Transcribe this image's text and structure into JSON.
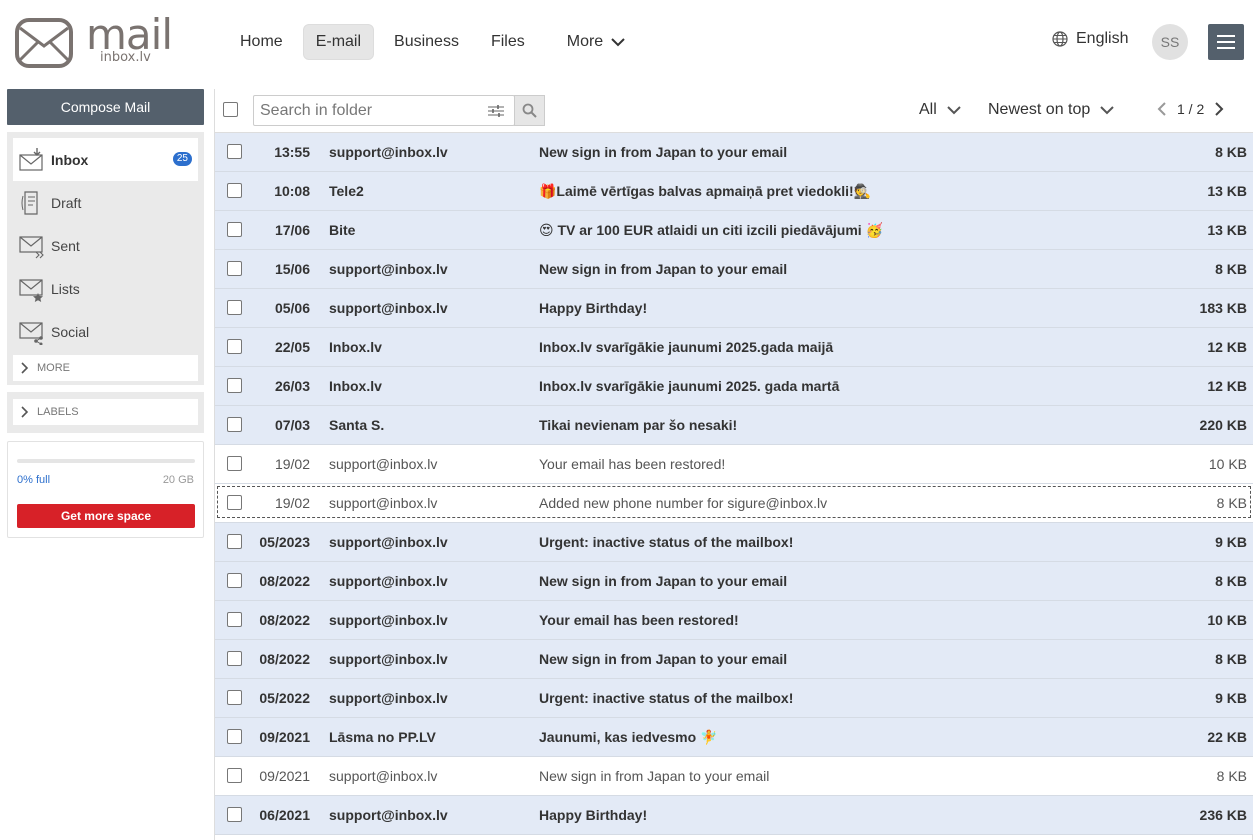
{
  "brand": {
    "name": "mail",
    "sub": "inbox.lv"
  },
  "nav": {
    "items": [
      {
        "label": "Home",
        "active": false
      },
      {
        "label": "E-mail",
        "active": true
      },
      {
        "label": "Business",
        "active": false
      },
      {
        "label": "Files",
        "active": false
      }
    ],
    "more_label": "More"
  },
  "header": {
    "language": "English",
    "avatar_initials": "SS"
  },
  "sidebar": {
    "compose_label": "Compose Mail",
    "folders": [
      {
        "label": "Inbox",
        "badge": "25",
        "icon": "inbox-icon"
      },
      {
        "label": "Draft",
        "icon": "draft-icon"
      },
      {
        "label": "Sent",
        "icon": "sent-icon"
      },
      {
        "label": "Lists",
        "icon": "lists-icon"
      },
      {
        "label": "Social",
        "icon": "social-icon"
      }
    ],
    "more_label": "MORE",
    "labels_label": "LABELS",
    "storage": {
      "percent_label": "0% full",
      "total": "20 GB",
      "fill_fraction": 0.0,
      "button_label": "Get more space"
    }
  },
  "toolbar": {
    "search_placeholder": "Search in folder",
    "filter_label": "All",
    "sort_label": "Newest on top",
    "page": "1 / 2"
  },
  "colors": {
    "accent": "#2c6fcd",
    "dark": "#54606c",
    "unread_bg": "#e3eaf6",
    "danger": "#d72128"
  },
  "messages": [
    {
      "date": "13:55",
      "from": "support@inbox.lv",
      "subject": "New sign in from Japan to your email",
      "size": "8 KB",
      "unread": true
    },
    {
      "date": "10:08",
      "from": "Tele2",
      "subject": "🎁Laimē vērtīgas balvas apmaiņā pret viedokli!🕵️",
      "size": "13 KB",
      "unread": true
    },
    {
      "date": "17/06",
      "from": "Bite",
      "subject": "😍 TV ar 100 EUR atlaidi un citi izcili piedāvājumi 🥳",
      "size": "13 KB",
      "unread": true
    },
    {
      "date": "15/06",
      "from": "support@inbox.lv",
      "subject": "New sign in from Japan to your email",
      "size": "8 KB",
      "unread": true
    },
    {
      "date": "05/06",
      "from": "support@inbox.lv",
      "subject": "Happy Birthday!",
      "size": "183 KB",
      "unread": true
    },
    {
      "date": "22/05",
      "from": "Inbox.lv",
      "subject": "Inbox.lv svarīgākie jaunumi 2025.gada maijā",
      "size": "12 KB",
      "unread": true
    },
    {
      "date": "26/03",
      "from": "Inbox.lv",
      "subject": "Inbox.lv svarīgākie jaunumi 2025. gada martā",
      "size": "12 KB",
      "unread": true
    },
    {
      "date": "07/03",
      "from": "Santa S.",
      "subject": "Tikai nevienam par šo nesaki!",
      "size": "220 KB",
      "unread": true
    },
    {
      "date": "19/02",
      "from": "support@inbox.lv",
      "subject": "Your email has been restored!",
      "size": "10 KB",
      "unread": false
    },
    {
      "date": "19/02",
      "from": "support@inbox.lv",
      "subject": "Added new phone number for sigure@inbox.lv",
      "size": "8 KB",
      "unread": false,
      "focused": true
    },
    {
      "date": "05/2023",
      "from": "support@inbox.lv",
      "subject": "Urgent: inactive status of the mailbox!",
      "size": "9 KB",
      "unread": true
    },
    {
      "date": "08/2022",
      "from": "support@inbox.lv",
      "subject": "New sign in from Japan to your email",
      "size": "8 KB",
      "unread": true
    },
    {
      "date": "08/2022",
      "from": "support@inbox.lv",
      "subject": "Your email has been restored!",
      "size": "10 KB",
      "unread": true
    },
    {
      "date": "08/2022",
      "from": "support@inbox.lv",
      "subject": "New sign in from Japan to your email",
      "size": "8 KB",
      "unread": true
    },
    {
      "date": "05/2022",
      "from": "support@inbox.lv",
      "subject": "Urgent: inactive status of the mailbox!",
      "size": "9 KB",
      "unread": true
    },
    {
      "date": "09/2021",
      "from": "Lāsma no PP.LV",
      "subject": "Jaunumi, kas iedvesmo 🧚",
      "size": "22 KB",
      "unread": true
    },
    {
      "date": "09/2021",
      "from": "support@inbox.lv",
      "subject": "New sign in from Japan to your email",
      "size": "8 KB",
      "unread": false
    },
    {
      "date": "06/2021",
      "from": "support@inbox.lv",
      "subject": "Happy Birthday!",
      "size": "236 KB",
      "unread": true
    }
  ]
}
